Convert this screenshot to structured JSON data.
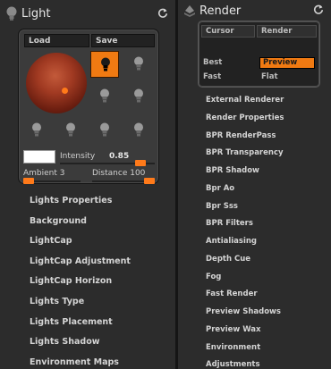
{
  "light": {
    "title": "Light",
    "load_label": "Load",
    "save_label": "Save",
    "intensity_label": "Intensity",
    "intensity_value": "0.85",
    "intensity_level": 0.85,
    "ambient_label": "Ambient 3",
    "ambient_level": 0.03,
    "distance_label": "Distance 100",
    "distance_level": 1.0,
    "selected_light": 1,
    "menu": [
      "Lights Properties",
      "Background",
      "LightCap",
      "LightCap Adjustment",
      "LightCap Horizon",
      "Lights Type",
      "Lights Placement",
      "Lights Shadow",
      "Environment Maps"
    ]
  },
  "render": {
    "title": "Render",
    "cursor_label": "Cursor",
    "render_label": "Render",
    "best_label": "Best",
    "preview_label": "Preview",
    "fast_label": "Fast",
    "flat_label": "Flat",
    "menu": [
      "External Renderer",
      "Render Properties",
      "BPR RenderPass",
      "BPR Transparency",
      "BPR Shadow",
      "Bpr Ao",
      "Bpr Sss",
      "BPR Filters",
      "Antialiasing",
      "Depth Cue",
      "Fog",
      "Fast Render",
      "Preview Shadows",
      "Preview Wax",
      "Environment",
      "Adjustments"
    ]
  },
  "colors": {
    "accent": "#f07a12",
    "panel": "#2c2c2c",
    "sphere": "#a13a22"
  }
}
